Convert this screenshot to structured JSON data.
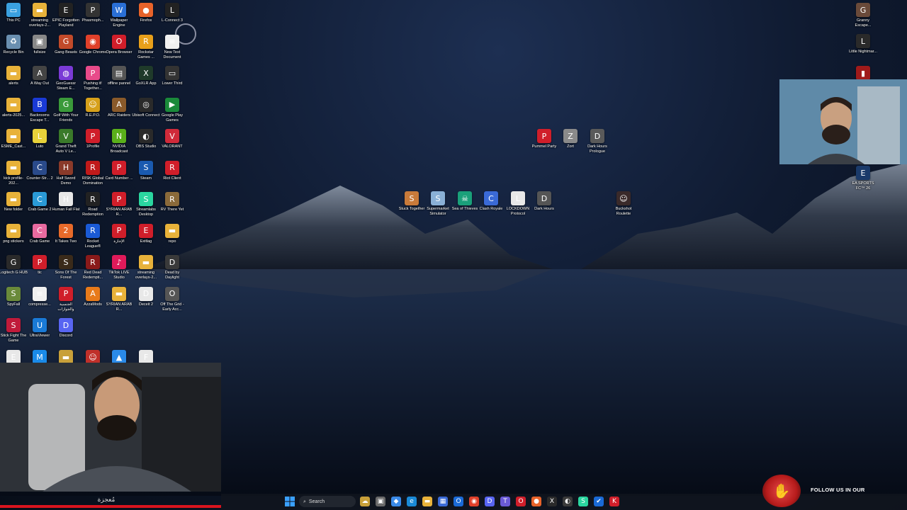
{
  "desktop": {
    "left_column_icons": [
      {
        "label": "This PC",
        "icon": "computer-icon",
        "color": "#3aa0e0",
        "glyph": "▭"
      },
      {
        "label": "streaming overlays-2...",
        "icon": "folder-icon",
        "color": "#e8b23a",
        "glyph": "▬"
      },
      {
        "label": "EPIC Forgotten Playland",
        "icon": "game-icon",
        "color": "#222222",
        "glyph": "E"
      },
      {
        "label": "Phasmoph...",
        "icon": "game-icon",
        "color": "#333333",
        "glyph": "P"
      },
      {
        "label": "Wallpaper Engine",
        "icon": "wallpaper-engine-icon",
        "color": "#2a6fd6",
        "glyph": "W"
      },
      {
        "label": "Firefox",
        "icon": "firefox-icon",
        "color": "#e8632a",
        "glyph": "●"
      },
      {
        "label": "L-Connect 3",
        "icon": "app-icon",
        "color": "#222222",
        "glyph": "L"
      },
      {
        "label": "Recycle Bin",
        "icon": "recycle-bin-icon",
        "color": "#6a8fb0",
        "glyph": "♻"
      },
      {
        "label": "fullsize",
        "icon": "image-file-icon",
        "color": "#888888",
        "glyph": "▣"
      },
      {
        "label": "Gang Beasts",
        "icon": "game-icon",
        "color": "#c24a2a",
        "glyph": "G"
      },
      {
        "label": "Google Chrome",
        "icon": "chrome-icon",
        "color": "#e0402a",
        "glyph": "◉"
      },
      {
        "label": "Opera Browser",
        "icon": "opera-icon",
        "color": "#d01e2a",
        "glyph": "O"
      },
      {
        "label": "Rockstar Games ...",
        "icon": "rockstar-icon",
        "color": "#e8a01a",
        "glyph": "R"
      },
      {
        "label": "New Text Document",
        "icon": "text-file-icon",
        "color": "#f0f0f0",
        "glyph": "≡"
      },
      {
        "label": "alerts",
        "icon": "folder-icon",
        "color": "#e8b23a",
        "glyph": "▬"
      },
      {
        "label": "A Way Out",
        "icon": "game-icon",
        "color": "#444444",
        "glyph": "A"
      },
      {
        "label": "GeoGuessr Steam E...",
        "icon": "geoguessr-icon",
        "color": "#7a3ad6",
        "glyph": "◍"
      },
      {
        "label": "Pushing it! Together...",
        "icon": "game-icon",
        "color": "#e84a8a",
        "glyph": "P"
      },
      {
        "label": "offline pannel",
        "icon": "app-icon",
        "color": "#555555",
        "glyph": "▤"
      },
      {
        "label": "GoXLR App",
        "icon": "goxlr-icon",
        "color": "#1f3a2a",
        "glyph": "X"
      },
      {
        "label": "Lower Third",
        "icon": "app-icon",
        "color": "#333333",
        "glyph": "▭"
      },
      {
        "label": "alerts-2025...",
        "icon": "folder-icon",
        "color": "#e8b23a",
        "glyph": "▬"
      },
      {
        "label": "Backrooms Escape T...",
        "icon": "game-icon",
        "color": "#1a3ad6",
        "glyph": "B"
      },
      {
        "label": "Golf With Your Friends",
        "icon": "game-icon",
        "color": "#3a9a3a",
        "glyph": "G"
      },
      {
        "label": "R.E.P.O.",
        "icon": "game-icon",
        "color": "#d6a01a",
        "glyph": "☺"
      },
      {
        "label": "ARC Raiders",
        "icon": "game-icon",
        "color": "#8a5a2a",
        "glyph": "A"
      },
      {
        "label": "Ubisoft Connect",
        "icon": "ubisoft-icon",
        "color": "#2a2a2a",
        "glyph": "◎"
      },
      {
        "label": "Google Play Games",
        "icon": "google-play-icon",
        "color": "#1a8a3a",
        "glyph": "▶"
      },
      {
        "label": "ESME_Cast...",
        "icon": "folder-icon",
        "color": "#e8b23a",
        "glyph": "▬"
      },
      {
        "label": "Luto",
        "icon": "game-icon",
        "color": "#e8d23a",
        "glyph": "L"
      },
      {
        "label": "Grand Theft Auto V Le...",
        "icon": "gta-icon",
        "color": "#3a7a2a",
        "glyph": "V"
      },
      {
        "label": "1Profile",
        "icon": "pdf-icon",
        "color": "#d01e2a",
        "glyph": "P"
      },
      {
        "label": "NVIDIA Broadcast",
        "icon": "nvidia-icon",
        "color": "#5ab01a",
        "glyph": "N"
      },
      {
        "label": "OBS Studio",
        "icon": "obs-icon",
        "color": "#2a2a2a",
        "glyph": "◐"
      },
      {
        "label": "VALORANT",
        "icon": "valorant-icon",
        "color": "#d02a3a",
        "glyph": "V"
      },
      {
        "label": "kick profile-202...",
        "icon": "folder-icon",
        "color": "#e8b23a",
        "glyph": "▬"
      },
      {
        "label": "Counter-Str... 2",
        "icon": "game-icon",
        "color": "#2a4a8a",
        "glyph": "C"
      },
      {
        "label": "Half Sword Demo",
        "icon": "game-icon",
        "color": "#8a3a2a",
        "glyph": "H"
      },
      {
        "label": "RISK Global Domination",
        "icon": "game-icon",
        "color": "#c01a1a",
        "glyph": "R"
      },
      {
        "label": "Card Number ...",
        "icon": "pdf-icon",
        "color": "#d01e2a",
        "glyph": "P"
      },
      {
        "label": "Steam",
        "icon": "steam-icon",
        "color": "#1a5ab0",
        "glyph": "S"
      },
      {
        "label": "Riot Client",
        "icon": "riot-icon",
        "color": "#d01e2a",
        "glyph": "R"
      },
      {
        "label": "New folder",
        "icon": "folder-icon",
        "color": "#e8b23a",
        "glyph": "▬"
      },
      {
        "label": "Crab Game 2",
        "icon": "game-icon",
        "color": "#2a9ad6",
        "glyph": "C"
      },
      {
        "label": "Human Fall Flat",
        "icon": "game-icon",
        "color": "#e8e8e8",
        "glyph": "H"
      },
      {
        "label": "Road Redemption",
        "icon": "game-icon",
        "color": "#222222",
        "glyph": "R"
      },
      {
        "label": "SYRIAN ARAB R...",
        "icon": "pdf-icon",
        "color": "#d01e2a",
        "glyph": "P"
      },
      {
        "label": "Streamlabs Desktop",
        "icon": "streamlabs-icon",
        "color": "#2ad6a0",
        "glyph": "S"
      },
      {
        "label": "RV There Yet",
        "icon": "game-icon",
        "color": "#8a6a3a",
        "glyph": "R"
      },
      {
        "label": "png stickers",
        "icon": "folder-icon",
        "color": "#e8b23a",
        "glyph": "▬"
      },
      {
        "label": "Crab Game",
        "icon": "game-icon",
        "color": "#e86aa0",
        "glyph": "C"
      },
      {
        "label": "It Takes Two",
        "icon": "game-icon",
        "color": "#e86a2a",
        "glyph": "2"
      },
      {
        "label": "Rocket League®",
        "icon": "rocket-league-icon",
        "color": "#1a5ad6",
        "glyph": "R"
      },
      {
        "label": "الإجازة",
        "icon": "pdf-icon",
        "color": "#d01e2a",
        "glyph": "P"
      },
      {
        "label": "Exitlag",
        "icon": "exitlag-icon",
        "color": "#d01e2a",
        "glyph": "E"
      },
      {
        "label": "repo",
        "icon": "folder-icon",
        "color": "#e8b23a",
        "glyph": "▬"
      },
      {
        "label": "Logitech G HUB",
        "icon": "logitech-icon",
        "color": "#2a2a2a",
        "glyph": "G"
      },
      {
        "label": "tic",
        "icon": "pdf-icon",
        "color": "#d01e2a",
        "glyph": "P"
      },
      {
        "label": "Sons Of The Forest",
        "icon": "game-icon",
        "color": "#3a2a1a",
        "glyph": "S"
      },
      {
        "label": "Red Dead Redempti...",
        "icon": "game-icon",
        "color": "#8a1a1a",
        "glyph": "R"
      },
      {
        "label": "TikTok LIVE Studio",
        "icon": "tiktok-icon",
        "color": "#e01a5a",
        "glyph": "♪"
      },
      {
        "label": "streaming overlays-2...",
        "icon": "folder-icon",
        "color": "#e8b23a",
        "glyph": "▬"
      },
      {
        "label": "Dead by Daylight",
        "icon": "game-icon",
        "color": "#3a3a3a",
        "glyph": "D"
      },
      {
        "label": "SpyFall",
        "icon": "game-icon",
        "color": "#6a8a3a",
        "glyph": "S"
      },
      {
        "label": "compresse...",
        "icon": "text-file-icon",
        "color": "#f0f0f0",
        "glyph": "≡"
      },
      {
        "label": "الجنسية والجوازات",
        "icon": "pdf-icon",
        "color": "#d01e2a",
        "glyph": "P"
      },
      {
        "label": "AzzaMods",
        "icon": "azzamods-icon",
        "color": "#e87a1a",
        "glyph": "A"
      },
      {
        "label": "SYRIAN ARAB R...",
        "icon": "folder-icon",
        "color": "#e8b23a",
        "glyph": "▬"
      },
      {
        "label": "Deceit 2",
        "icon": "game-icon",
        "color": "#e8e8e8",
        "glyph": "D"
      },
      {
        "label": "Off The Grid - Early Acc...",
        "icon": "game-icon",
        "color": "#555555",
        "glyph": "O"
      },
      {
        "label": "Stick Fight The Game",
        "icon": "game-icon",
        "color": "#c01a3a",
        "glyph": "S"
      },
      {
        "label": "UltraViewer",
        "icon": "ultraviewer-icon",
        "color": "#1a7ad6",
        "glyph": "U"
      },
      {
        "label": "Discord",
        "icon": "discord-icon",
        "color": "#5865f2",
        "glyph": "D"
      }
    ],
    "bottom_partial_icons": [
      {
        "icon": "app-icon",
        "color": "#e8e8e8",
        "glyph": "E"
      },
      {
        "icon": "app-icon",
        "color": "#1a8ae8",
        "glyph": "M"
      },
      {
        "icon": "game-icon",
        "color": "#c8a03a",
        "glyph": "▬"
      },
      {
        "icon": "game-icon",
        "color": "#c0302a",
        "glyph": "☺"
      },
      {
        "icon": "app-icon",
        "color": "#2a8ae8",
        "glyph": "▲"
      },
      {
        "icon": "app-icon",
        "color": "#e8e8e8",
        "glyph": "F"
      }
    ],
    "upper_cluster": [
      {
        "label": "Pummel Party",
        "icon": "game-icon",
        "color": "#d01e2a",
        "glyph": "P"
      },
      {
        "label": "Zort",
        "icon": "game-icon",
        "color": "#8a8a8a",
        "glyph": "Z"
      },
      {
        "label": "Dark Hours Prologue",
        "icon": "game-icon",
        "color": "#5a5a5a",
        "glyph": "D"
      }
    ],
    "middle_cluster": [
      {
        "label": "Stuck Together",
        "icon": "game-icon",
        "color": "#c87a3a",
        "glyph": "S"
      },
      {
        "label": "Supermarket Simulator",
        "icon": "game-icon",
        "color": "#8ab0d6",
        "glyph": "S"
      },
      {
        "label": "Sea of Thieves",
        "icon": "game-icon",
        "color": "#1aa07a",
        "glyph": "☠"
      },
      {
        "label": "Clash Royale",
        "icon": "game-icon",
        "color": "#3a6ad6",
        "glyph": "C"
      },
      {
        "label": "LOCKDOWN Protocol",
        "icon": "game-icon",
        "color": "#e8e8e8",
        "glyph": "L"
      },
      {
        "label": "Dark Hours",
        "icon": "game-icon",
        "color": "#555555",
        "glyph": "D"
      }
    ],
    "roulette": {
      "label": "Buckshot Roulette",
      "icon": "game-icon",
      "color": "#3a2a2a",
      "glyph": "☺"
    },
    "right_column_icons": [
      {
        "label": "Granny Escape...",
        "icon": "game-icon",
        "color": "#6a4a3a",
        "glyph": "G"
      },
      {
        "label": "Little Nightmar...",
        "icon": "game-icon",
        "color": "#2a2a2a",
        "glyph": "L"
      },
      {
        "label": "",
        "icon": "game-icon",
        "color": "#a01a1a",
        "glyph": "▮"
      },
      {
        "label": "EA SPORTS FC™ 26",
        "icon": "ea-sports-icon",
        "color": "#1a3a6a",
        "glyph": "E"
      }
    ]
  },
  "webcam_overlay": {
    "caption": "مُعجزة",
    "progress": 1.0,
    "progress_color": "#d9141e"
  },
  "taskbar": {
    "search_label": "Search",
    "apps": [
      {
        "icon": "weather-icon",
        "color": "#c8a03a",
        "glyph": "☁"
      },
      {
        "icon": "task-view-icon",
        "color": "#6a6a6a",
        "glyph": "▣"
      },
      {
        "icon": "copilot-icon",
        "color": "#3a8ae8",
        "glyph": "◆"
      },
      {
        "icon": "edge-icon",
        "color": "#1a8ad6",
        "glyph": "e"
      },
      {
        "icon": "file-explorer-icon",
        "color": "#e8b23a",
        "glyph": "▬"
      },
      {
        "icon": "store-icon",
        "color": "#3a6ad6",
        "glyph": "▦"
      },
      {
        "icon": "outlook-icon",
        "color": "#1a6ad6",
        "glyph": "O"
      },
      {
        "icon": "chrome-icon",
        "color": "#e0402a",
        "glyph": "◉"
      },
      {
        "icon": "discord-icon",
        "color": "#5865f2",
        "glyph": "D"
      },
      {
        "icon": "teams-icon",
        "color": "#6a5ad6",
        "glyph": "T"
      },
      {
        "icon": "opera-icon",
        "color": "#d01e2a",
        "glyph": "O"
      },
      {
        "icon": "firefox-icon",
        "color": "#e8632a",
        "glyph": "●"
      },
      {
        "icon": "goxlr-icon",
        "color": "#2a2a2a",
        "glyph": "X"
      },
      {
        "icon": "obs-icon",
        "color": "#3a3a3a",
        "glyph": "◐"
      },
      {
        "icon": "streamlabs-icon",
        "color": "#2ad6a0",
        "glyph": "S"
      },
      {
        "icon": "app-icon",
        "color": "#1a6ad6",
        "glyph": "✔"
      },
      {
        "icon": "app-icon",
        "color": "#d01e2a",
        "glyph": "K"
      }
    ]
  },
  "follow_banner": {
    "text": "FOLLOW US IN OUR",
    "badge_glyph": "✋"
  }
}
